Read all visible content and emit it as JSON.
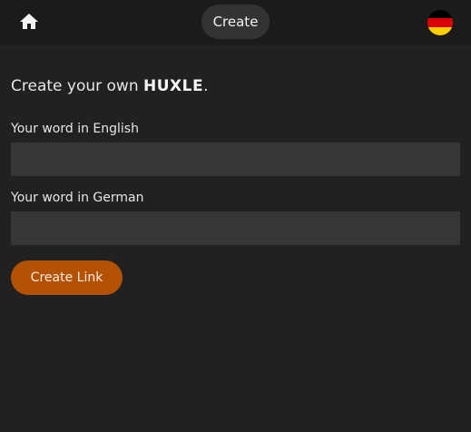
{
  "header": {
    "home_icon": "home-icon",
    "center_label": "Create",
    "language_flag": "germany-flag-icon",
    "flag_colors": [
      "#000000",
      "#dd0000",
      "#ffce00"
    ]
  },
  "main": {
    "heading_prefix": "Create your own ",
    "heading_brand": "HUXLE",
    "heading_suffix": ".",
    "english_label": "Your word in English",
    "english_value": "",
    "german_label": "Your word in German",
    "german_value": "",
    "submit_label": "Create Link"
  },
  "colors": {
    "background": "#212121",
    "topbar": "#1b1b1b",
    "input": "#363636",
    "accent": "#b35205"
  }
}
